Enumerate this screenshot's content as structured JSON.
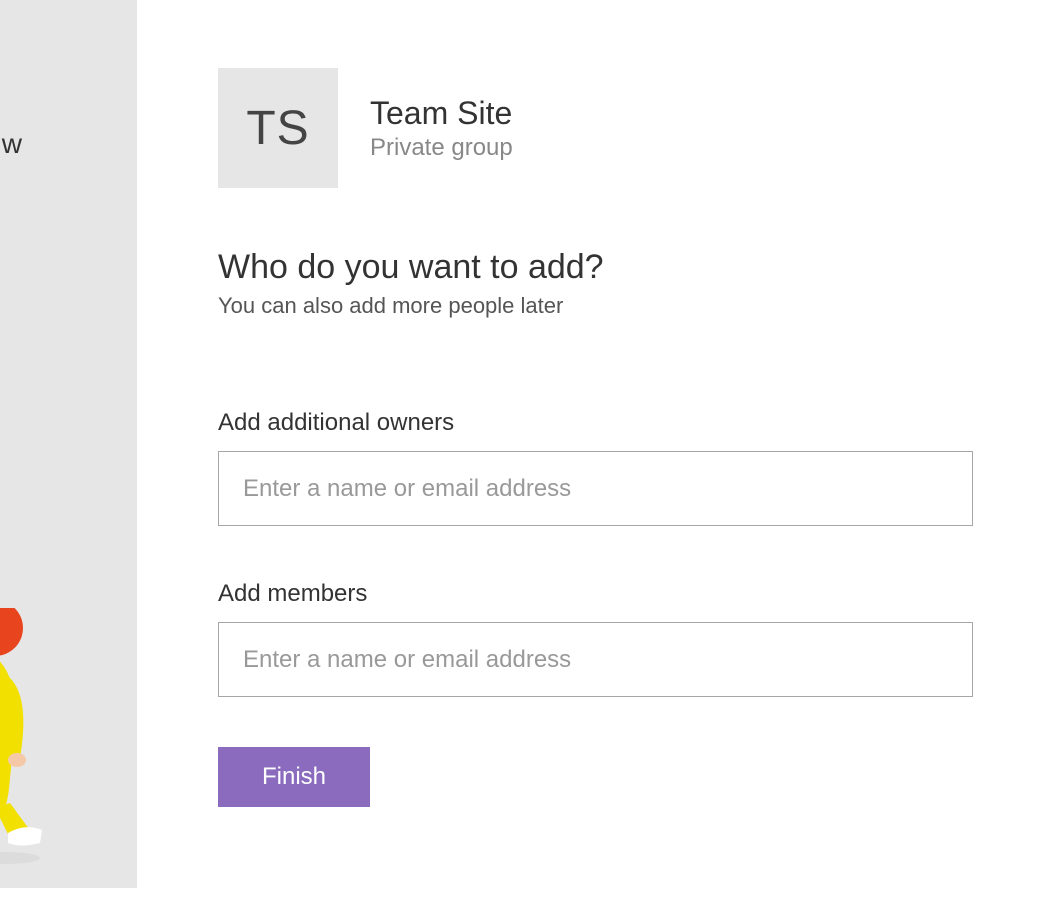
{
  "sidebar": {
    "partial_text": "w"
  },
  "site": {
    "logo_initials": "TS",
    "title": "Team Site",
    "subtitle": "Private group"
  },
  "prompt": {
    "heading": "Who do you want to add?",
    "sub": "You can also add more people later"
  },
  "owners": {
    "label": "Add additional owners",
    "placeholder": "Enter a name or email address"
  },
  "members": {
    "label": "Add members",
    "placeholder": "Enter a name or email address"
  },
  "buttons": {
    "finish": "Finish"
  }
}
